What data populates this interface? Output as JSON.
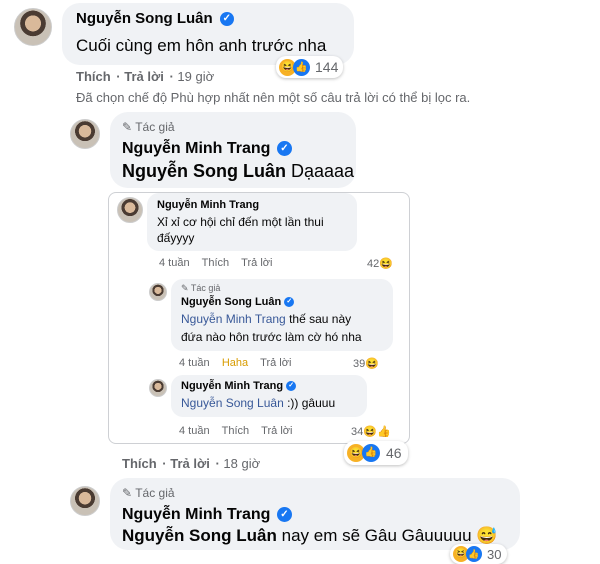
{
  "comment1": {
    "name": "Nguyễn Song Luân",
    "text": "Cuối cùng em hôn anh trước nha",
    "like": "Thích",
    "reply": "Trả lời",
    "time": "19 giờ",
    "reaction_count": "144"
  },
  "filter_notice": "Đã chọn chế độ Phù hợp nhất nên một số câu trả lời có thể bị lọc ra.",
  "reply1": {
    "author_label": "Tác giả",
    "name": "Nguyễn Minh Trang",
    "mention": "Nguyễn Song Luân",
    "text": "Dạaaaa",
    "like": "Thích",
    "reply": "Trả lời",
    "time": "18 giờ",
    "reaction_count": "46"
  },
  "shared": {
    "c1": {
      "name": "Nguyễn Minh Trang",
      "text_line1": "Xỉ xỉ cơ hội chỉ đến một lần thui",
      "text_line2": "đấyyyy",
      "time": "4 tuần",
      "like": "Thích",
      "reply": "Trả lời",
      "reaction_count": "42"
    },
    "c2": {
      "author_label": "Tác giả",
      "name": "Nguyễn Song Luân",
      "mention": "Nguyễn Minh Trang",
      "text_line1": "thế sau này",
      "text_line2": "đứa nào hôn trước làm cờ hó nha",
      "time": "4 tuần",
      "like": "Haha",
      "reply": "Trả lời",
      "reaction_count": "39"
    },
    "c3": {
      "name": "Nguyễn Minh Trang",
      "mention": "Nguyễn Song Luân",
      "text": ":)) gâuuu",
      "time": "4 tuần",
      "like": "Thích",
      "reply": "Trả lời",
      "reaction_count": "34"
    }
  },
  "reply2": {
    "author_label": "Tác giả",
    "name": "Nguyễn Minh Trang",
    "mention": "Nguyễn Song Luân",
    "text": "nay em sẽ Gâu Gâuuuuu",
    "reaction_count": "30"
  },
  "colors": {
    "accent": "#1877f2",
    "mention": "#385898",
    "haha": "#f7b125",
    "bubble": "#f0f2f5"
  }
}
